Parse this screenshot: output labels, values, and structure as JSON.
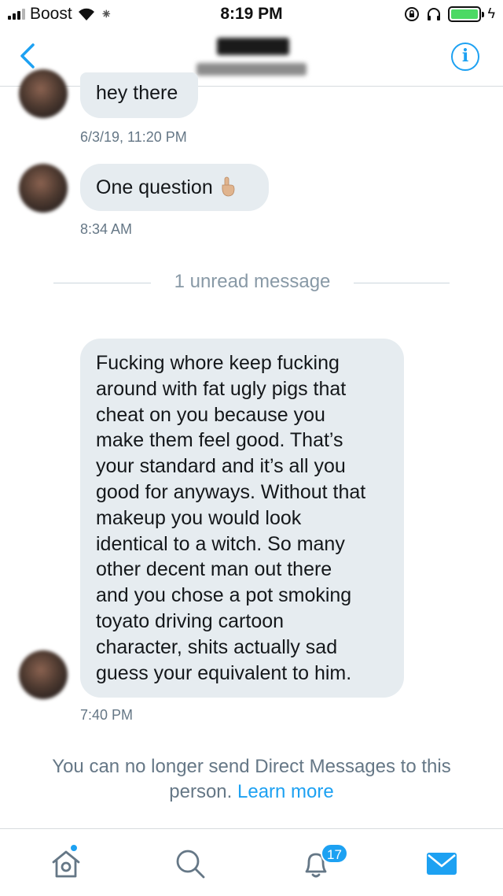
{
  "status_bar": {
    "carrier": "Boost",
    "time": "8:19 PM",
    "signal_bars": 4,
    "signal_bars_filled": 3,
    "battery_level": 1.0,
    "charging": true
  },
  "header": {
    "back_icon": "chevron-left-icon",
    "info_icon": "info-icon",
    "info_glyph": "i",
    "contact_name_redacted": true,
    "contact_handle_redacted": true
  },
  "messages": [
    {
      "text": "hey there",
      "timestamp": "6/3/19, 11:20 PM"
    },
    {
      "text": "One question",
      "emoji": "pointing-up-hand",
      "timestamp": "8:34 AM"
    },
    {
      "lines": [
        "Fucking whore keep fucking",
        "around with fat ugly pigs that",
        "cheat on you because you",
        "make them feel good. That’s",
        "your standard and it’s all you",
        "good for anyways. Without that",
        "makeup you would look",
        "identical to a witch. So many",
        "other decent man out there",
        "and you chose a pot smoking",
        "toyato driving cartoon",
        "character, shits actually sad",
        "guess your equivalent to him."
      ],
      "timestamp": "7:40 PM"
    }
  ],
  "unread_divider": "1 unread message",
  "notice": {
    "line1": "You can no longer send Direct Messages to this",
    "line2": "person.",
    "link": "Learn more"
  },
  "tabbar": {
    "home_icon": "home-icon",
    "search_icon": "search-icon",
    "notifications_icon": "bell-icon",
    "notifications_badge": "17",
    "messages_icon": "envelope-icon",
    "active_tab": "messages"
  },
  "colors": {
    "accent": "#1da1f2",
    "bubble": "#e6ecf0",
    "muted_text": "#657786",
    "battery": "#4cd964"
  }
}
